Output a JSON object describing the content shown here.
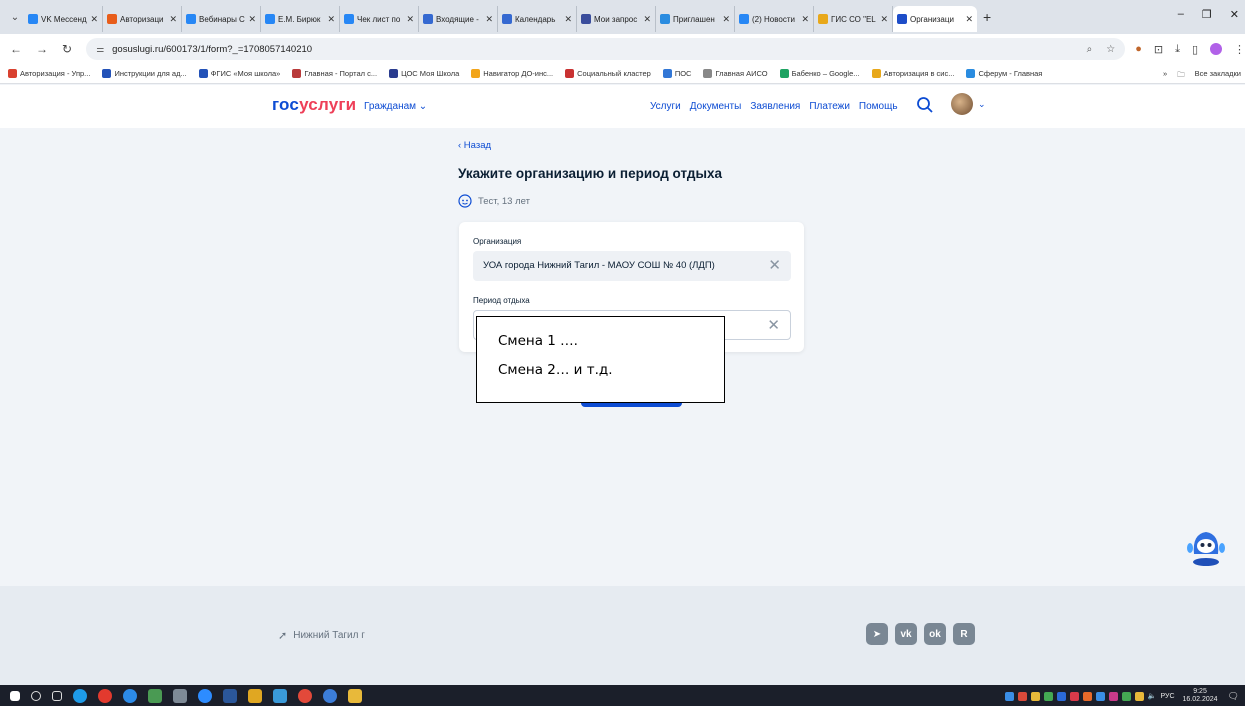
{
  "browser": {
    "tabs": [
      {
        "title": "VK Мессенд",
        "color": "#2787f5"
      },
      {
        "title": "Авторизаци",
        "color": "#e85d1a"
      },
      {
        "title": "Вебинары С",
        "color": "#2787f5"
      },
      {
        "title": "Е.М. Бирюк",
        "color": "#2787f5"
      },
      {
        "title": "Чек лист по",
        "color": "#2787f5"
      },
      {
        "title": "Входящие -",
        "color": "#3569d1"
      },
      {
        "title": "Календарь",
        "color": "#3569d1"
      },
      {
        "title": "Мои запрос",
        "color": "#3a4d9c"
      },
      {
        "title": "Приглашен",
        "color": "#2a8ce0"
      },
      {
        "title": "(2) Новости",
        "color": "#2787f5"
      },
      {
        "title": "ГИС СО \"ЕL",
        "color": "#e8a81a"
      },
      {
        "title": "Организаци",
        "color": "#1d4dc8"
      }
    ],
    "url": "gosuslugi.ru/600173/1/form?_=1708057140210",
    "bookmarks": [
      {
        "label": "Авторизация - Упр...",
        "color": "#d9412f"
      },
      {
        "label": "Инструкции для ад...",
        "color": "#2352b8"
      },
      {
        "label": "ФГИС «Моя школа»",
        "color": "#2352b8"
      },
      {
        "label": "Главная - Портал с...",
        "color": "#b93a3a"
      },
      {
        "label": "ЦОС Моя Школа",
        "color": "#2a3c8f"
      },
      {
        "label": "Навигатор ДО-инс...",
        "color": "#f2a51a"
      },
      {
        "label": "Социальный кластер",
        "color": "#c93232"
      },
      {
        "label": "ПОС",
        "color": "#3277d6"
      },
      {
        "label": "Главная АИСО",
        "color": "#888888"
      },
      {
        "label": "Бабенко – Google...",
        "color": "#1ea362"
      },
      {
        "label": "Авторизация в сис...",
        "color": "#e8a81a"
      },
      {
        "label": "Сферум - Главная",
        "color": "#2a8ce0"
      }
    ],
    "bookmarks_more": "»",
    "all_bookmarks": "Все закладки"
  },
  "header": {
    "logo_part1": "гос",
    "logo_part2": "услуги",
    "citizen_menu": "Гражданам ⌄",
    "nav": [
      "Услуги",
      "Документы",
      "Заявления",
      "Платежи",
      "Помощь"
    ]
  },
  "main": {
    "back": "‹ Назад",
    "title": "Укажите организацию и период отдыха",
    "child": "Тест, 13 лет",
    "org_label": "Организация",
    "org_value": "УОА города Нижний Тагил - МАОУ СОШ № 40 (ЛДП)",
    "period_label": "Период отдыха",
    "period_value": ""
  },
  "overlay": {
    "line1": "Смена 1 ….",
    "line2": "Смена 2… и т.д."
  },
  "footer": {
    "location": "Нижний Тагил г",
    "socials": [
      "tg",
      "vk",
      "ok",
      "R"
    ]
  },
  "taskbar": {
    "lang": "РУС",
    "time": "9:25",
    "date": "16.02.2024"
  }
}
